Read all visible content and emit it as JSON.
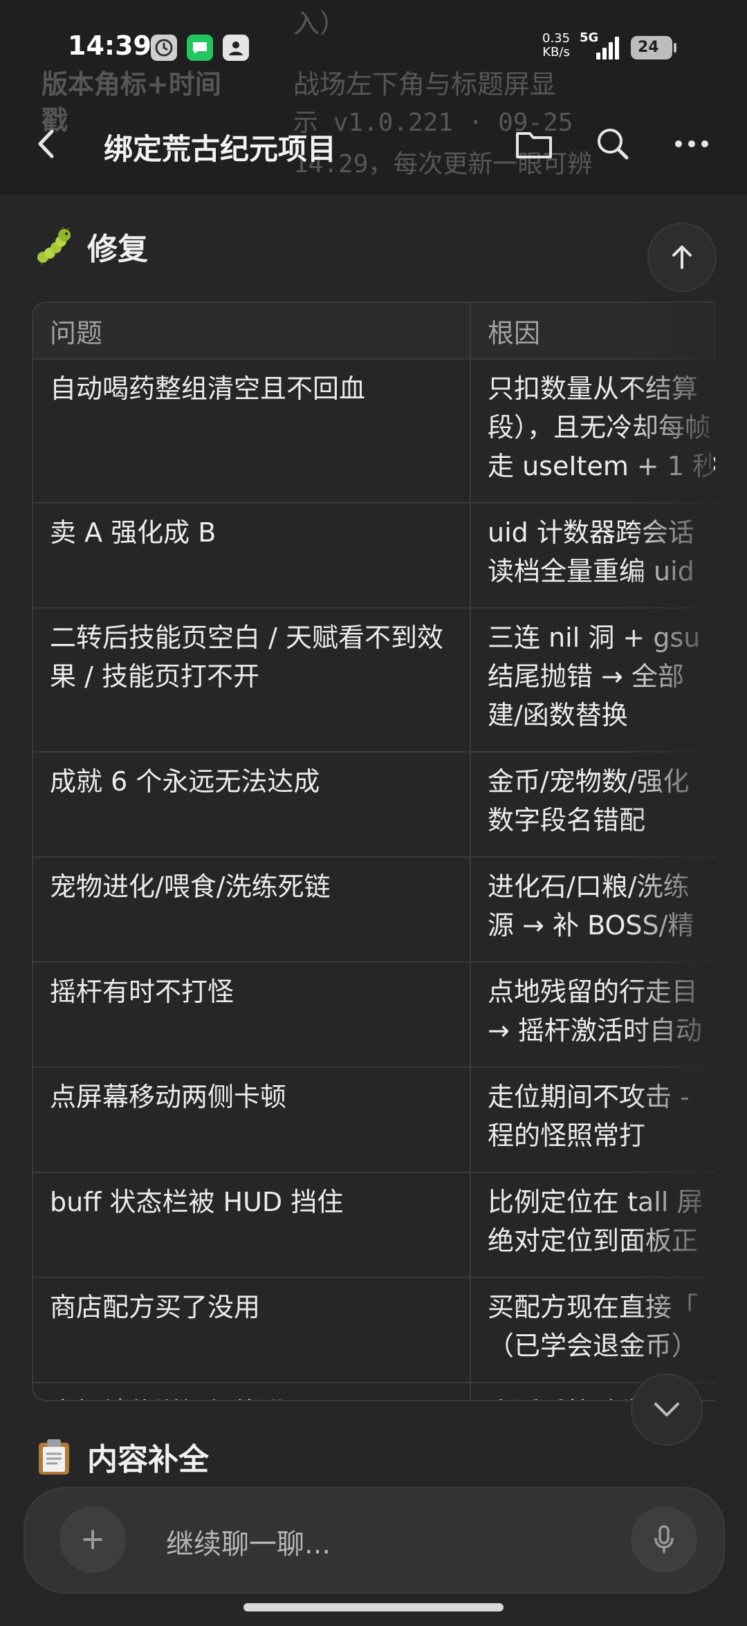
{
  "background_ghost": {
    "left_text": "版本角标+时间\n戳",
    "right_line1": "入）",
    "right_line2": "战场左下角与标题屏显",
    "right_line3": "示 v1.0.221 · 09-25",
    "right_line4": "14:29，每次更新一眼可辨"
  },
  "status_bar": {
    "time": "14:39",
    "net_speed": "0.35\nKB/s",
    "network": "5G",
    "battery": "24"
  },
  "title_bar": {
    "title": "绑定荒古纪元项目"
  },
  "fix_section": {
    "emoji": "caterpillar-icon",
    "title": "修复",
    "headers": [
      "问题",
      "根因"
    ],
    "rows": [
      {
        "issue": "自动喝药整组清空且不回血",
        "cause": "只扣数量从不结算\n段），且无冷却每帧\n走 useItem + 1 秒"
      },
      {
        "issue": "卖 A 强化成 B",
        "cause": "uid 计数器跨会话\n读档全量重编 uid"
      },
      {
        "issue": "二转后技能页空白 / 天赋看不到效果 / 技能页打不开",
        "cause": "三连 nil 洞 + gsu\n结尾抛错 → 全部\n建/函数替换"
      },
      {
        "issue": "成就 6 个永远无法达成",
        "cause": "金币/宠物数/强化\n数字段名错配"
      },
      {
        "issue": "宠物进化/喂食/洗练死链",
        "cause": "进化石/口粮/洗练\n源 → 补 BOSS/精"
      },
      {
        "issue": "摇杆有时不打怪",
        "cause": "点地残留的行走目\n→ 摇杆激活时自动"
      },
      {
        "issue": "点屏幕移动两侧卡顿",
        "cause": "走位期间不攻击 -\n程的怪照常打"
      },
      {
        "issue": "buff 状态栏被 HUD 挡住",
        "cause": "比例定位在 tall 屏\n绝对定位到面板正"
      },
      {
        "issue": "商店配方买了没用",
        "cause": "买配方现在直接「\n（已学会退金币）"
      },
      {
        "issue": "未解锁传送门仍能进",
        "cause": "走近后校验失败现\n提示缺的条件"
      }
    ]
  },
  "next_section": {
    "emoji": "clipboard-icon",
    "title": "内容补全"
  },
  "composer": {
    "placeholder": "继续聊一聊..."
  }
}
